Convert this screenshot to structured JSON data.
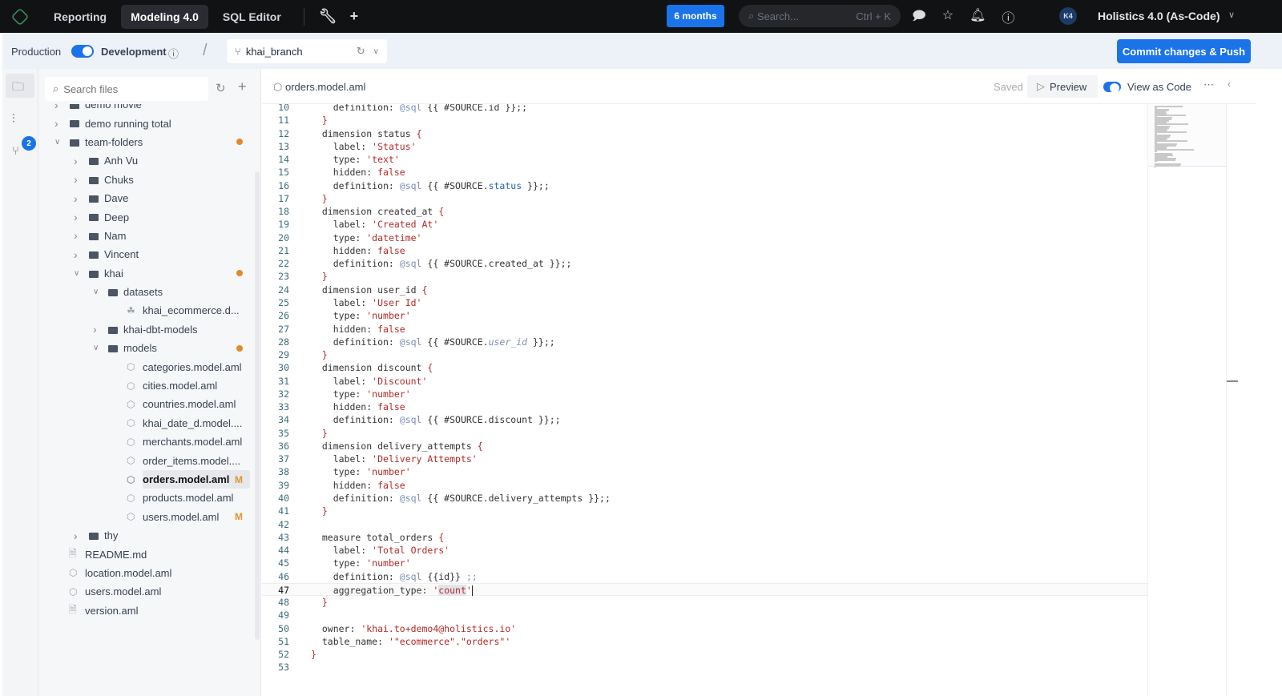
{
  "topbar": {
    "tabs": [
      {
        "label": "Reporting"
      },
      {
        "label": "Modeling 4.0",
        "active": true
      },
      {
        "label": "SQL Editor"
      }
    ],
    "period_label": "6 months",
    "search_placeholder": "Search...",
    "search_shortcut": "Ctrl + K",
    "avatar_initials": "K4",
    "workspace": "Holistics 4.0 (As-Code)"
  },
  "envbar": {
    "production_label": "Production",
    "development_label": "Development",
    "mode_toggle_on": true,
    "branch": "khai_branch",
    "commit_label": "Commit changes & Push"
  },
  "rail": {
    "git_badge": "2"
  },
  "files": {
    "search_placeholder": "Search files",
    "tree": [
      {
        "label": "demo movie",
        "depth": 0,
        "type": "folder",
        "expanded": false
      },
      {
        "label": "demo running total",
        "depth": 0,
        "type": "folder",
        "expanded": false
      },
      {
        "label": "team-folders",
        "depth": 0,
        "type": "folder",
        "expanded": true,
        "modified_dot": true
      },
      {
        "label": "Anh Vu",
        "depth": 1,
        "type": "folder",
        "expanded": false
      },
      {
        "label": "Chuks",
        "depth": 1,
        "type": "folder",
        "expanded": false
      },
      {
        "label": "Dave",
        "depth": 1,
        "type": "folder",
        "expanded": false
      },
      {
        "label": "Deep",
        "depth": 1,
        "type": "folder",
        "expanded": false
      },
      {
        "label": "Nam",
        "depth": 1,
        "type": "folder",
        "expanded": false
      },
      {
        "label": "Vincent",
        "depth": 1,
        "type": "folder",
        "expanded": false
      },
      {
        "label": "khai",
        "depth": 1,
        "type": "folder",
        "expanded": true,
        "modified_dot": true
      },
      {
        "label": "datasets",
        "depth": 2,
        "type": "folder",
        "expanded": true
      },
      {
        "label": "khai_ecommerce.d...",
        "depth": 3,
        "type": "dataset"
      },
      {
        "label": "khai-dbt-models",
        "depth": 2,
        "type": "folder",
        "expanded": false
      },
      {
        "label": "models",
        "depth": 2,
        "type": "folder",
        "expanded": true,
        "modified_dot": true
      },
      {
        "label": "categories.model.aml",
        "depth": 3,
        "type": "model"
      },
      {
        "label": "cities.model.aml",
        "depth": 3,
        "type": "model"
      },
      {
        "label": "countries.model.aml",
        "depth": 3,
        "type": "model"
      },
      {
        "label": "khai_date_d.model....",
        "depth": 3,
        "type": "model"
      },
      {
        "label": "merchants.model.aml",
        "depth": 3,
        "type": "model"
      },
      {
        "label": "order_items.model....",
        "depth": 3,
        "type": "model"
      },
      {
        "label": "orders.model.aml",
        "depth": 3,
        "type": "model",
        "selected": true,
        "status": "M"
      },
      {
        "label": "products.model.aml",
        "depth": 3,
        "type": "model"
      },
      {
        "label": "users.model.aml",
        "depth": 3,
        "type": "model",
        "status": "M"
      },
      {
        "label": "thy",
        "depth": 1,
        "type": "folder",
        "expanded": false
      },
      {
        "label": "README.md",
        "depth": 0,
        "type": "file"
      },
      {
        "label": "location.model.aml",
        "depth": 0,
        "type": "model"
      },
      {
        "label": "users.model.aml",
        "depth": 0,
        "type": "model"
      },
      {
        "label": "version.aml",
        "depth": 0,
        "type": "file"
      }
    ]
  },
  "editor": {
    "filename": "orders.model.aml",
    "status": "Saved",
    "preview_label": "Preview",
    "view_as_code_label": "View as Code",
    "view_as_code_on": true,
    "current_line": 47,
    "lines": [
      {
        "n": 10,
        "t": [
          [
            "k",
            "    definition: "
          ],
          [
            "a",
            "@sql"
          ],
          [
            "k",
            " {{ #SOURCE.id }};;"
          ]
        ]
      },
      {
        "n": 11,
        "t": [
          [
            "b",
            "  }"
          ]
        ]
      },
      {
        "n": 12,
        "t": [
          [
            "k",
            "  dimension status "
          ],
          [
            "b",
            "{"
          ]
        ]
      },
      {
        "n": 13,
        "t": [
          [
            "k",
            "    label: "
          ],
          [
            "s",
            "'Status'"
          ]
        ]
      },
      {
        "n": 14,
        "t": [
          [
            "k",
            "    type: "
          ],
          [
            "s",
            "'text'"
          ]
        ]
      },
      {
        "n": 15,
        "t": [
          [
            "k",
            "    hidden: "
          ],
          [
            "f",
            "false"
          ]
        ]
      },
      {
        "n": 16,
        "t": [
          [
            "k",
            "    definition: "
          ],
          [
            "a",
            "@sql"
          ],
          [
            "k",
            " {{ #SOURCE."
          ],
          [
            "v",
            "status"
          ],
          [
            "k",
            " }};;"
          ]
        ]
      },
      {
        "n": 17,
        "t": [
          [
            "b",
            "  }"
          ]
        ]
      },
      {
        "n": 18,
        "t": [
          [
            "k",
            "  dimension created_at "
          ],
          [
            "b",
            "{"
          ]
        ]
      },
      {
        "n": 19,
        "t": [
          [
            "k",
            "    label: "
          ],
          [
            "s",
            "'Created At'"
          ]
        ]
      },
      {
        "n": 20,
        "t": [
          [
            "k",
            "    type: "
          ],
          [
            "s",
            "'datetime'"
          ]
        ]
      },
      {
        "n": 21,
        "t": [
          [
            "k",
            "    hidden: "
          ],
          [
            "f",
            "false"
          ]
        ]
      },
      {
        "n": 22,
        "t": [
          [
            "k",
            "    definition: "
          ],
          [
            "a",
            "@sql"
          ],
          [
            "k",
            " {{ #SOURCE.created_at }};;"
          ]
        ]
      },
      {
        "n": 23,
        "t": [
          [
            "b",
            "  }"
          ]
        ]
      },
      {
        "n": 24,
        "t": [
          [
            "k",
            "  dimension user_id "
          ],
          [
            "b",
            "{"
          ]
        ]
      },
      {
        "n": 25,
        "t": [
          [
            "k",
            "    label: "
          ],
          [
            "s",
            "'User Id'"
          ]
        ]
      },
      {
        "n": 26,
        "t": [
          [
            "k",
            "    type: "
          ],
          [
            "s",
            "'number'"
          ]
        ]
      },
      {
        "n": 27,
        "t": [
          [
            "k",
            "    hidden: "
          ],
          [
            "f",
            "false"
          ]
        ]
      },
      {
        "n": 28,
        "t": [
          [
            "k",
            "    definition: "
          ],
          [
            "a",
            "@sql"
          ],
          [
            "k",
            " {{ #SOURCE."
          ],
          [
            "i",
            "user_id"
          ],
          [
            "k",
            " }};;"
          ]
        ]
      },
      {
        "n": 29,
        "t": [
          [
            "b",
            "  }"
          ]
        ]
      },
      {
        "n": 30,
        "t": [
          [
            "k",
            "  dimension discount "
          ],
          [
            "b",
            "{"
          ]
        ]
      },
      {
        "n": 31,
        "t": [
          [
            "k",
            "    label: "
          ],
          [
            "s",
            "'Discount'"
          ]
        ]
      },
      {
        "n": 32,
        "t": [
          [
            "k",
            "    type: "
          ],
          [
            "s",
            "'number'"
          ]
        ]
      },
      {
        "n": 33,
        "t": [
          [
            "k",
            "    hidden: "
          ],
          [
            "f",
            "false"
          ]
        ]
      },
      {
        "n": 34,
        "t": [
          [
            "k",
            "    definition: "
          ],
          [
            "a",
            "@sql"
          ],
          [
            "k",
            " {{ #SOURCE.discount }};;"
          ]
        ]
      },
      {
        "n": 35,
        "t": [
          [
            "b",
            "  }"
          ]
        ]
      },
      {
        "n": 36,
        "t": [
          [
            "k",
            "  dimension delivery_attempts "
          ],
          [
            "b",
            "{"
          ]
        ]
      },
      {
        "n": 37,
        "t": [
          [
            "k",
            "    label: "
          ],
          [
            "s",
            "'Delivery Attempts'"
          ]
        ]
      },
      {
        "n": 38,
        "t": [
          [
            "k",
            "    type: "
          ],
          [
            "s",
            "'number'"
          ]
        ]
      },
      {
        "n": 39,
        "t": [
          [
            "k",
            "    hidden: "
          ],
          [
            "f",
            "false"
          ]
        ]
      },
      {
        "n": 40,
        "t": [
          [
            "k",
            "    definition: "
          ],
          [
            "a",
            "@sql"
          ],
          [
            "k",
            " {{ #SOURCE.delivery_attempts }};;"
          ]
        ]
      },
      {
        "n": 41,
        "t": [
          [
            "b",
            "  }"
          ]
        ]
      },
      {
        "n": 42,
        "t": []
      },
      {
        "n": 43,
        "t": [
          [
            "k",
            "  measure total_orders "
          ],
          [
            "b",
            "{"
          ]
        ]
      },
      {
        "n": 44,
        "t": [
          [
            "k",
            "    label: "
          ],
          [
            "s",
            "'Total Orders'"
          ]
        ]
      },
      {
        "n": 45,
        "t": [
          [
            "k",
            "    type: "
          ],
          [
            "s",
            "'number'"
          ]
        ]
      },
      {
        "n": 46,
        "t": [
          [
            "k",
            "    definition: "
          ],
          [
            "a",
            "@sql"
          ],
          [
            "k",
            " {{id}} "
          ],
          [
            "a",
            ";;"
          ]
        ]
      },
      {
        "n": 47,
        "t": [
          [
            "k",
            "    aggregation_type: "
          ],
          [
            "s",
            "'"
          ],
          [
            "h",
            "count"
          ],
          [
            "s",
            "'"
          ]
        ]
      },
      {
        "n": 48,
        "t": [
          [
            "b",
            "  }"
          ]
        ]
      },
      {
        "n": 49,
        "t": []
      },
      {
        "n": 50,
        "t": [
          [
            "k",
            "  owner: "
          ],
          [
            "s",
            "'khai.to+demo4@holistics.io'"
          ]
        ]
      },
      {
        "n": 51,
        "t": [
          [
            "k",
            "  table_name: "
          ],
          [
            "s",
            "'\"ecommerce\".\"orders\"'"
          ]
        ]
      },
      {
        "n": 52,
        "t": [
          [
            "b",
            "}"
          ]
        ]
      },
      {
        "n": 53,
        "t": []
      }
    ]
  },
  "colors": {
    "accent": "#1a73e8",
    "modified": "#e08a2c",
    "string": "#b22a2a",
    "topbar": "#111214"
  }
}
